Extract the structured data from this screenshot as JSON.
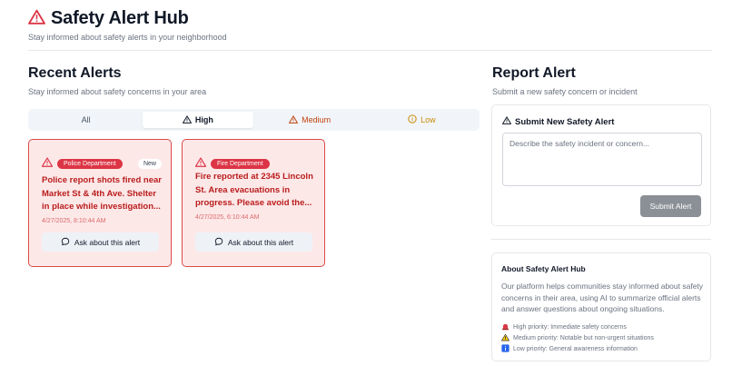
{
  "header": {
    "title": "Safety Alert Hub",
    "subtitle": "Stay informed about safety alerts in your neighborhood"
  },
  "alerts": {
    "title": "Recent Alerts",
    "subtitle": "Stay informed about safety concerns in your area",
    "tabs": [
      {
        "label": "All"
      },
      {
        "label": "High"
      },
      {
        "label": "Medium"
      },
      {
        "label": "Low"
      }
    ],
    "cards": [
      {
        "source": "Police Department",
        "tag": "New",
        "text": "Police report shots fired near Market St & 4th Ave. Shelter in place while investigation...",
        "time": "4/27/2025, 8:10:44 AM",
        "action": "Ask about this alert"
      },
      {
        "source": "Fire Department",
        "text": "Fire reported at 2345 Lincoln St. Area evacuations in progress. Please avoid the...",
        "time": "4/27/2025, 6:10:44 AM",
        "action": "Ask about this alert"
      }
    ]
  },
  "report": {
    "title": "Report Alert",
    "subtitle": "Submit a new safety concern or incident",
    "form_title": "Submit New Safety Alert",
    "placeholder": "Describe the safety incident or concern...",
    "submit_label": "Submit Alert"
  },
  "about": {
    "title": "About Safety Alert Hub",
    "text": "Our platform helps communities stay informed about safety concerns in their area, using AI to summarize official alerts and answer questions about ongoing situations.",
    "legend": [
      {
        "icon": "red-siren-icon",
        "label": "High priority: Immediate safety concerns"
      },
      {
        "icon": "warning-triangle-icon",
        "label": "Medium priority: Notable but non-urgent situations"
      },
      {
        "icon": "info-square-icon",
        "label": "Low priority: General awareness information"
      }
    ]
  },
  "colors": {
    "high": "#dc3545",
    "medium": "#c2410c",
    "low": "#ca8a04",
    "card_bg": "#fde8e8"
  }
}
